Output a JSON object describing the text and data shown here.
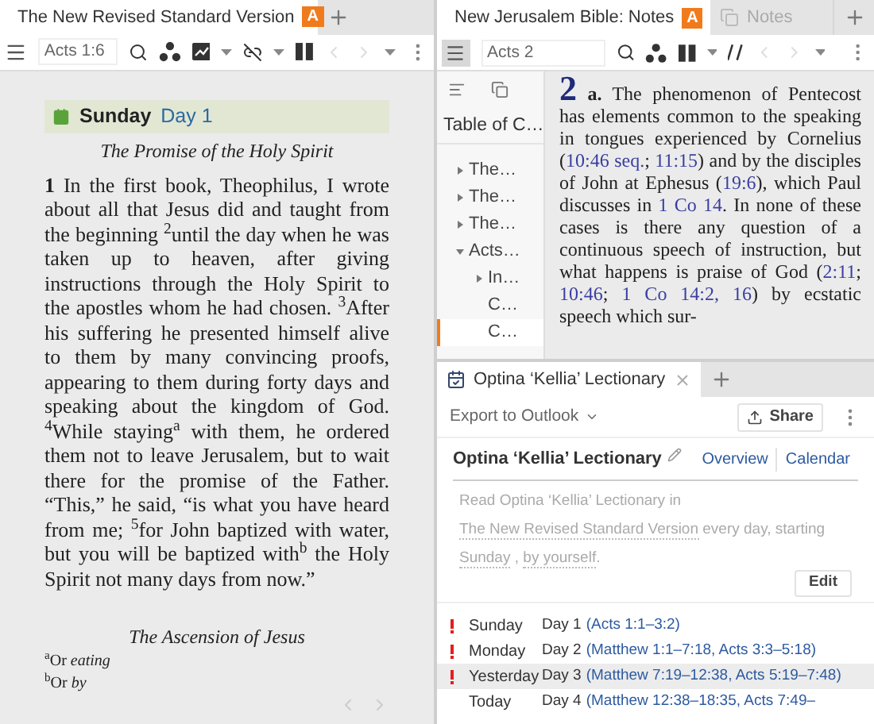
{
  "reading_pane": {
    "tab": {
      "title": "The New Revised Standard Version",
      "badge": "A"
    },
    "toolbar": {
      "reference": "Acts 1:6"
    },
    "plan_header": {
      "day": "Sunday",
      "label": "Day 1"
    },
    "section_title": "The Promise of the Holy Spirit",
    "passage": "**1** In the first book, Theophilus, I wrote about all that Jesus did and taught from the beginning $^{2}$until the day when he was taken up to heaven, after giving instructions through the Holy Spirit to the apostles whom he had chosen. $^{3}$After his suffering he presented himself alive to them by many convincing proofs, appearing to them during forty days and speaking about the kingdom of God. $^{4}$While staying$^{a}$ with them, he ordered them not to leave Jerusalem, but to wait there for the promise of the Father. “This,” he said, “is what you have heard from me; $^{5}$for John baptized with water, but you will be baptized with$^{b}$ the Holy Spirit not many days from now.”",
    "next_section_title": "The Ascension of Jesus",
    "footnotes": [
      "$^{a}$Or *eating*",
      "$^{b}$Or *by*"
    ]
  },
  "notes_pane": {
    "tabs": [
      {
        "title": "New Jerusalem Bible: Notes",
        "badge": "A",
        "selected": true
      },
      {
        "title": "Notes",
        "selected": false
      }
    ],
    "toolbar": {
      "menu_active": true,
      "reference": "Acts 2"
    },
    "toc": {
      "title": "Table of C…",
      "items": [
        {
          "label": "The…",
          "kind": "branch",
          "expanded": false,
          "selected": false
        },
        {
          "label": "The…",
          "kind": "branch",
          "expanded": false,
          "selected": false
        },
        {
          "label": "The…",
          "kind": "branch",
          "expanded": false,
          "selected": false
        },
        {
          "label": "Acts…",
          "kind": "branch",
          "expanded": true,
          "selected": false,
          "children": [
            {
              "label": "In…",
              "kind": "branch",
              "expanded": false,
              "selected": false
            },
            {
              "label": "C…",
              "kind": "leaf",
              "selected": false
            },
            {
              "label": "C…",
              "kind": "leaf",
              "selected": true
            }
          ]
        }
      ]
    },
    "note": {
      "chapter": "2",
      "segments": [
        {
          "kind": "text",
          "text": " **a.** The phenomenon of Pentecost has elements common to the speaking in tongues experienced by Cornelius ("
        },
        {
          "kind": "link",
          "text": "10:46 seq."
        },
        {
          "kind": "text",
          "text": "; "
        },
        {
          "kind": "link",
          "text": "11:15"
        },
        {
          "kind": "text",
          "text": ") and by the disciples of John at Ephesus ("
        },
        {
          "kind": "link",
          "text": "19:6"
        },
        {
          "kind": "text",
          "text": "), which Paul discusses in "
        },
        {
          "kind": "link",
          "text": "1 Co 14"
        },
        {
          "kind": "text",
          "text": ". In none of these cases is there any question of a continuous speech of instruction, but what happens is praise of God ("
        },
        {
          "kind": "link",
          "text": "2:11"
        },
        {
          "kind": "text",
          "text": "; "
        },
        {
          "kind": "link",
          "text": "10:46"
        },
        {
          "kind": "text",
          "text": "; "
        },
        {
          "kind": "link",
          "text": "1 Co 14:2, 16"
        },
        {
          "kind": "text",
          "text": ") by ecstatic speech which sur-"
        }
      ]
    }
  },
  "lectionary_pane": {
    "tab": {
      "title": "Optina ‘Kellia’ Lectionary"
    },
    "toolbar": {
      "export": "Export to Outlook",
      "share": "Share"
    },
    "title": "Optina ‘Kellia’ Lectionary",
    "views": [
      "Overview",
      "Calendar"
    ],
    "description": [
      {
        "kind": "text",
        "text": "Read Optina ‘Kellia’ Lectionary in "
      },
      {
        "kind": "choice",
        "text": "The New Revised Standard Version"
      },
      {
        "kind": "text",
        "text": " every day, starting "
      },
      {
        "kind": "choice",
        "text": "Sunday"
      },
      {
        "kind": "text",
        "text": " , "
      },
      {
        "kind": "choice",
        "text": "by yourself"
      },
      {
        "kind": "text",
        "text": "."
      }
    ],
    "edit": "Edit",
    "days": [
      {
        "day": "Sunday",
        "label": "Day 1",
        "refs": "(Acts 1:1–3:2)",
        "overdue": true,
        "selected": false
      },
      {
        "day": "Monday",
        "label": "Day 2",
        "refs": "(Matthew 1:1–7:18, Acts 3:3–5:18)",
        "overdue": true,
        "selected": false
      },
      {
        "day": "Yesterday",
        "label": "Day 3",
        "refs": "(Matthew 7:19–12:38, Acts 5:19–7:48)",
        "overdue": true,
        "selected": true
      },
      {
        "day": "Today",
        "label": "Day 4",
        "refs": "(Matthew 12:38–18:35, Acts 7:49–",
        "overdue": false,
        "selected": false
      }
    ]
  }
}
